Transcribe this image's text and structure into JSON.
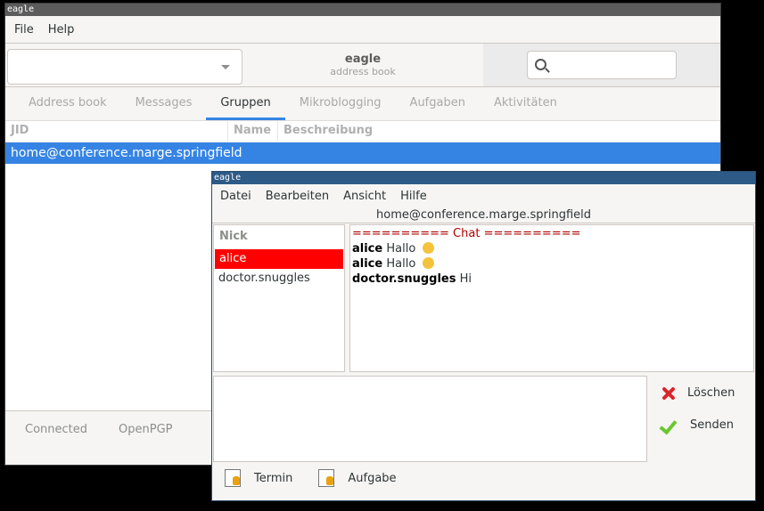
{
  "main_window": {
    "title": "eagle",
    "menu": [
      "File",
      "Help"
    ],
    "app_title": "eagle",
    "app_subtitle": "address book",
    "search_placeholder": "",
    "tabs": [
      "Address book",
      "Messages",
      "Gruppen",
      "Mikroblogging",
      "Aufgaben",
      "Aktivitäten"
    ],
    "active_tab": "Gruppen",
    "columns": [
      "JID",
      "Name",
      "Beschreibung"
    ],
    "rows": [
      {
        "jid": "home@conference.marge.springfield",
        "name": "",
        "description": ""
      }
    ],
    "status": [
      "Connected",
      "OpenPGP"
    ]
  },
  "chat_window": {
    "title": "eagle",
    "menu": [
      "Datei",
      "Bearbeiten",
      "Ansicht",
      "Hilfe"
    ],
    "room": "home@conference.marge.springfield",
    "nick_header": "Nick",
    "nicks": [
      "alice",
      "doctor.snuggles"
    ],
    "selected_nick": "alice",
    "log_separator": "========== Chat ==========",
    "messages": [
      {
        "nick": "alice",
        "text": "Hallo",
        "emoji": "hugging-face-emoji"
      },
      {
        "nick": "alice",
        "text": "Hallo",
        "emoji": "sunglasses-emoji"
      },
      {
        "nick": "doctor.snuggles",
        "text": "Hi",
        "emoji": ""
      }
    ],
    "input_value": "",
    "buttons": {
      "delete": "Löschen",
      "send": "Senden",
      "appointment": "Termin",
      "task": "Aufgabe"
    }
  }
}
